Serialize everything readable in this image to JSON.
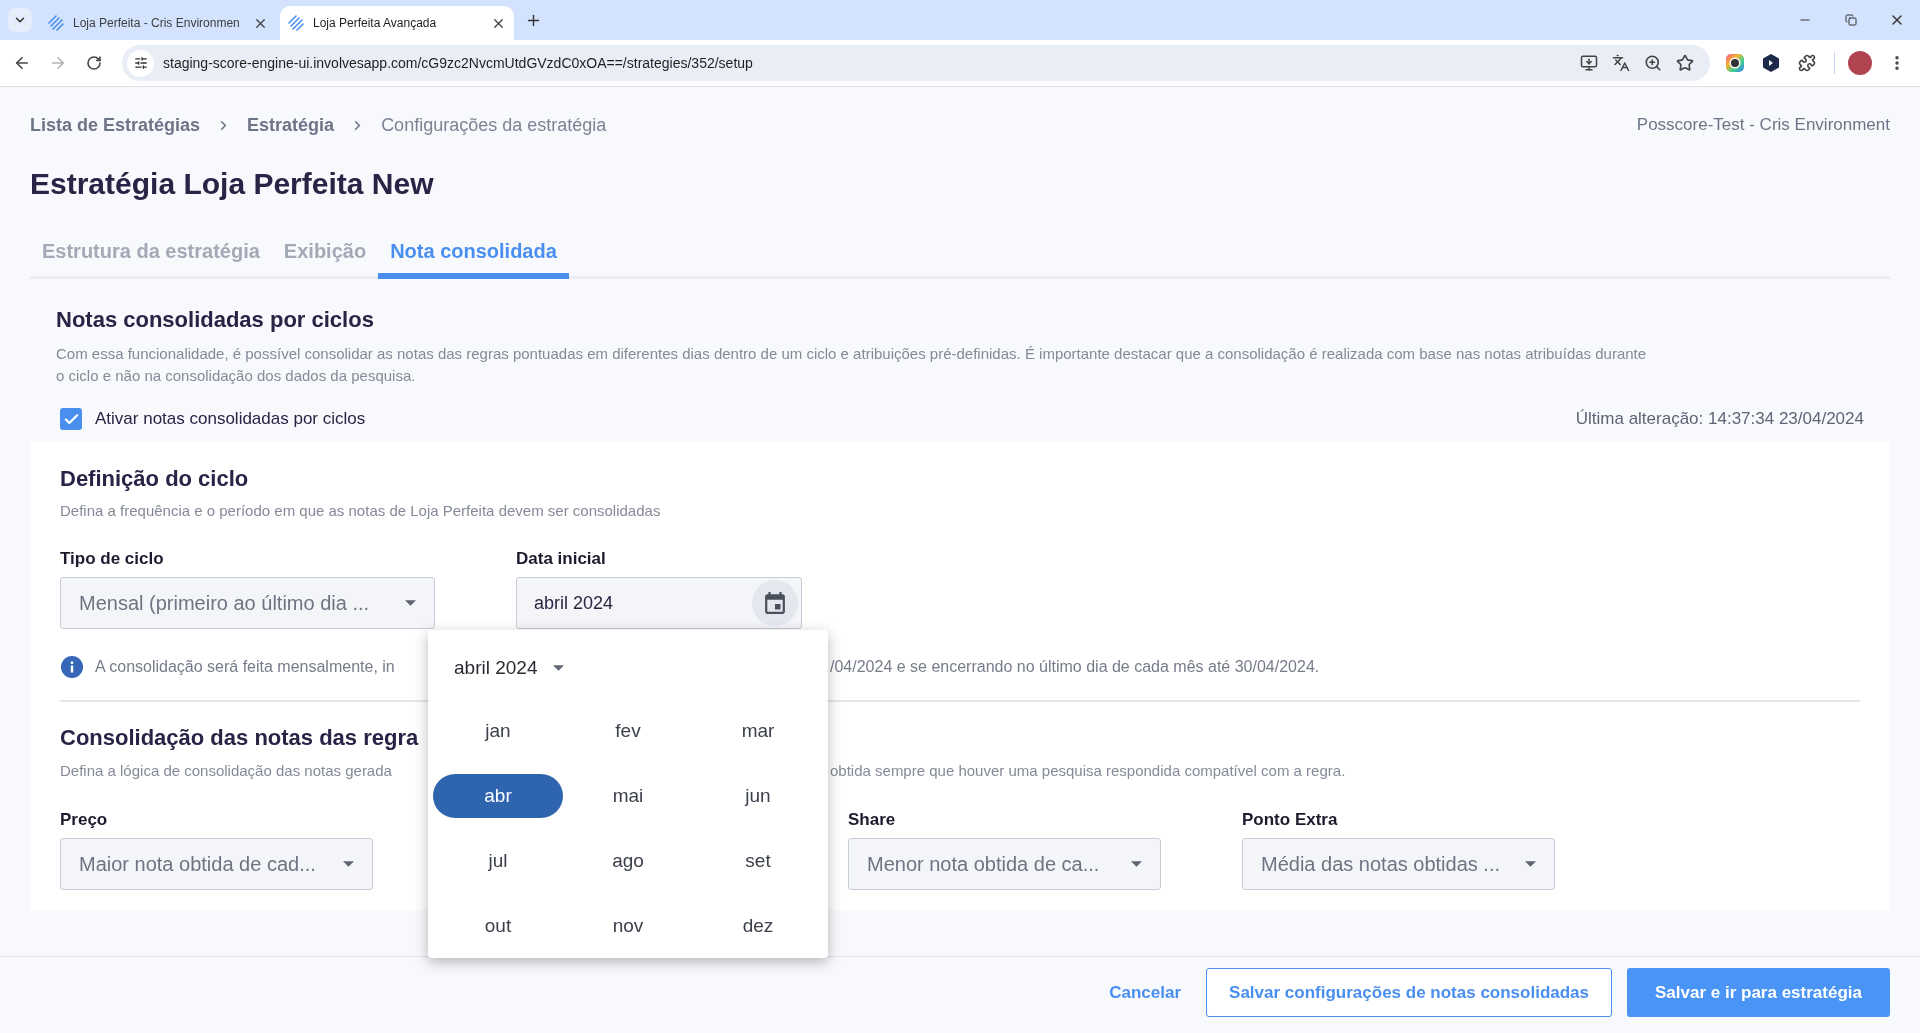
{
  "browser": {
    "tabs": [
      {
        "title": "Loja Perfeita - Cris Environmen",
        "selected": false
      },
      {
        "title": "Loja Perfeita Avançada",
        "selected": true
      }
    ],
    "url": "staging-score-engine-ui.involvesapp.com/cG9zc2NvcmUtdGVzdC0xOA==/strategies/352/setup"
  },
  "breadcrumb": [
    {
      "label": "Lista de Estratégias",
      "kind": "link"
    },
    {
      "label": "Estratégia",
      "kind": "link"
    },
    {
      "label": "Configurações da estratégia",
      "kind": "current"
    }
  ],
  "environment": "Posscore-Test - Cris Environment",
  "title": "Estratégia Loja Perfeita New",
  "tabs": [
    {
      "label": "Estrutura da estratégia",
      "selected": false
    },
    {
      "label": "Exibição",
      "selected": false
    },
    {
      "label": "Nota consolidada",
      "selected": true
    }
  ],
  "consolidation": {
    "heading": "Notas consolidadas por ciclos",
    "description": "Com essa funcionalidade, é possível consolidar as notas das regras pontuadas em diferentes dias dentro de um ciclo e atribuições pré-definidas. É importante destacar que a consolidação é realizada com base nas notas atribuídas durante o ciclo e não na consolidação dos dados da pesquisa.",
    "toggle": {
      "label": "Ativar notas consolidadas por ciclos",
      "checked": true
    },
    "last_modified": "Última alteração: 14:37:34 23/04/2024"
  },
  "cycle_definition": {
    "heading": "Definição do ciclo",
    "description": "Defina a frequência e o período em que as notas de Loja Perfeita devem ser consolidadas",
    "fields": [
      {
        "label": "Tipo de ciclo",
        "kind": "select",
        "value": "Mensal (primeiro ao último dia ..."
      },
      {
        "label": "Data inicial",
        "kind": "date",
        "value": "abril 2024"
      }
    ],
    "info": {
      "left": "A consolidação será feita mensalmente, in",
      "right": "/04/2024 e se encerrando no último dia de cada mês até 30/04/2024."
    }
  },
  "rule_consolidation": {
    "heading": "Consolidação das notas das regra",
    "description": {
      "left": "Defina a lógica de consolidação das notas gerada",
      "right": "obtida sempre que houver uma pesquisa respondida compatível com a regra."
    },
    "fields_left": [
      {
        "label": "Preço",
        "value": "Maior nota obtida de cad..."
      }
    ],
    "fields_right": [
      {
        "label": "Share",
        "value": "Menor nota obtida de ca..."
      },
      {
        "label": "Ponto Extra",
        "value": "Média das notas obtidas ..."
      }
    ]
  },
  "month_picker": {
    "header": "abril 2024",
    "months": [
      {
        "label": "jan",
        "selected": false
      },
      {
        "label": "fev",
        "selected": false
      },
      {
        "label": "mar",
        "selected": false
      },
      {
        "label": "abr",
        "selected": true
      },
      {
        "label": "mai",
        "selected": false
      },
      {
        "label": "jun",
        "selected": false
      },
      {
        "label": "jul",
        "selected": false
      },
      {
        "label": "ago",
        "selected": false
      },
      {
        "label": "set",
        "selected": false
      },
      {
        "label": "out",
        "selected": false
      },
      {
        "label": "nov",
        "selected": false
      },
      {
        "label": "dez",
        "selected": false
      }
    ]
  },
  "footer_buttons": [
    {
      "label": "Cancelar",
      "kind": "text"
    },
    {
      "label": "Salvar configurações de notas consolidadas",
      "kind": "outline"
    },
    {
      "label": "Salvar e ir para estratégia",
      "kind": "primary"
    }
  ]
}
